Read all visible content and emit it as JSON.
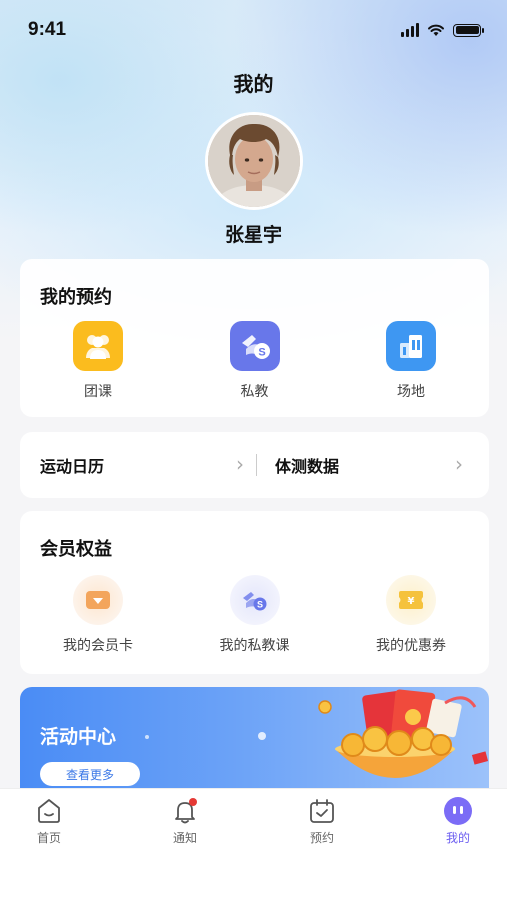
{
  "status": {
    "time": "9:41"
  },
  "header": {
    "title": "我的",
    "username": "张星宇"
  },
  "booking": {
    "title": "我的预约",
    "items": [
      {
        "label": "团课",
        "icon": "group-icon",
        "color": "#fbbc1e"
      },
      {
        "label": "私教",
        "icon": "coach-icon",
        "color": "#6877ea"
      },
      {
        "label": "场地",
        "icon": "building-icon",
        "color": "#3e97f2"
      }
    ]
  },
  "links": {
    "calendar": "运动日历",
    "body_data": "体测数据"
  },
  "benefits": {
    "title": "会员权益",
    "items": [
      {
        "label": "我的会员卡",
        "icon": "member-card-icon",
        "color": "#f3a55c"
      },
      {
        "label": "我的私教课",
        "icon": "coach-course-icon",
        "color": "#6877ea"
      },
      {
        "label": "我的优惠券",
        "icon": "coupon-icon",
        "color": "#f5c23c"
      }
    ]
  },
  "banner": {
    "title": "活动中心",
    "button": "查看更多"
  },
  "tabbar": {
    "items": [
      {
        "label": "首页",
        "icon": "home-icon",
        "active": false
      },
      {
        "label": "通知",
        "icon": "bell-icon",
        "active": false
      },
      {
        "label": "预约",
        "icon": "calendar-icon",
        "active": false
      },
      {
        "label": "我的",
        "icon": "profile-icon",
        "active": true
      }
    ],
    "active_color": "#6a5cf0"
  }
}
